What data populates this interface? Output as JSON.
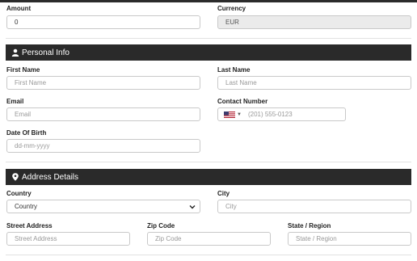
{
  "payment": {
    "amount_label": "Amount",
    "amount_value": "0",
    "currency_label": "Currency",
    "currency_value": "EUR"
  },
  "personal": {
    "title": "Personal Info",
    "first_name_label": "First Name",
    "first_name_placeholder": "First Name",
    "last_name_label": "Last Name",
    "last_name_placeholder": "Last Name",
    "email_label": "Email",
    "email_placeholder": "Email",
    "contact_label": "Contact Number",
    "contact_placeholder": "(201) 555-0123",
    "dob_label": "Date Of Birth",
    "dob_placeholder": "dd-mm-yyyy"
  },
  "address": {
    "title": "Address Details",
    "country_label": "Country",
    "country_value": "Country",
    "city_label": "City",
    "city_placeholder": "City",
    "street_label": "Street Address",
    "street_placeholder": "Street Address",
    "zip_label": "Zip Code",
    "zip_placeholder": "Zip Code",
    "state_label": "State / Region",
    "state_placeholder": "State / Region"
  },
  "colors": {
    "section_bar": "#2a2a2a",
    "input_border": "#c9c9c9",
    "readonly_bg": "#ebebeb",
    "placeholder": "#999999"
  },
  "icons": {
    "personal": "user-icon",
    "address": "map-marker-icon",
    "country_select": "chevron-down-icon",
    "phone_country": "us-flag-icon"
  }
}
